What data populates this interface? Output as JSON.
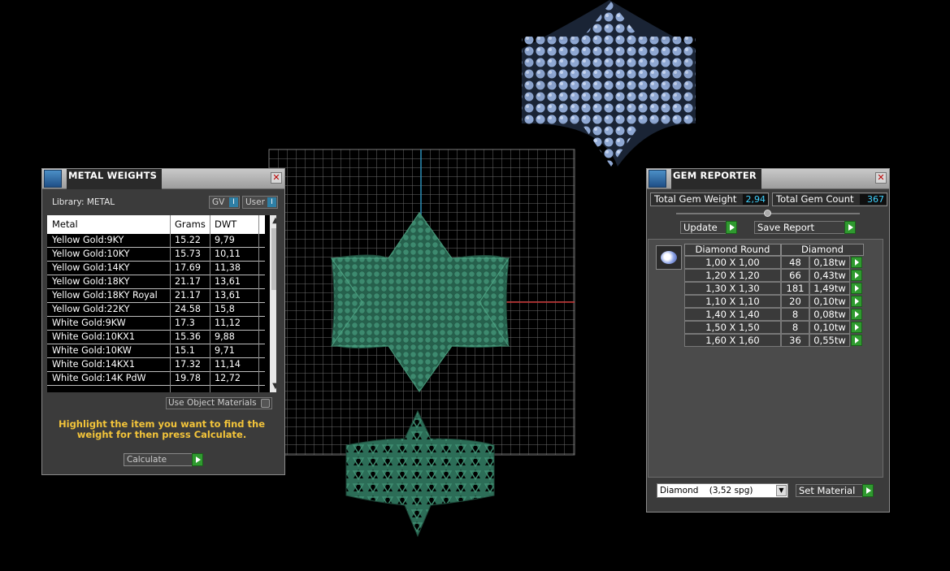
{
  "metal_weights": {
    "title": "METAL WEIGHTS",
    "library_label": "Library: METAL",
    "toggle_gv": "GV",
    "toggle_user": "User",
    "columns": [
      "Metal",
      "Grams",
      "DWT"
    ],
    "rows": [
      {
        "metal": "Yellow Gold:9KY",
        "grams": "15.22",
        "dwt": "9,79"
      },
      {
        "metal": "Yellow Gold:10KY",
        "grams": "15.73",
        "dwt": "10,11"
      },
      {
        "metal": "Yellow Gold:14KY",
        "grams": "17.69",
        "dwt": "11,38"
      },
      {
        "metal": "Yellow Gold:18KY",
        "grams": "21.17",
        "dwt": "13,61"
      },
      {
        "metal": "Yellow Gold:18KY Royal",
        "grams": "21.17",
        "dwt": "13,61"
      },
      {
        "metal": "Yellow Gold:22KY",
        "grams": "24.58",
        "dwt": "15,8"
      },
      {
        "metal": "White Gold:9KW",
        "grams": "17.3",
        "dwt": "11,12"
      },
      {
        "metal": "White Gold:10KX1",
        "grams": "15.36",
        "dwt": "9,88"
      },
      {
        "metal": "White Gold:10KW",
        "grams": "15.1",
        "dwt": "9,71"
      },
      {
        "metal": "White Gold:14KX1",
        "grams": "17.32",
        "dwt": "11,14"
      },
      {
        "metal": "White Gold:14K PdW",
        "grams": "19.78",
        "dwt": "12,72"
      }
    ],
    "use_object_materials": "Use Object Materials",
    "hint": "Highlight the item you want to find the weight for then press Calculate.",
    "calculate_label": "Calculate"
  },
  "gem_reporter": {
    "title": "GEM REPORTER",
    "total_gem_weight_label": "Total Gem Weight",
    "total_gem_weight": "2,94",
    "total_gem_count_label": "Total Gem Count",
    "total_gem_count": "367",
    "update_label": "Update",
    "save_report_label": "Save Report",
    "headers": [
      "Diamond Round",
      "Diamond"
    ],
    "rows": [
      {
        "size": "1,00 X 1,00",
        "count": "48",
        "weight": "0,18tw"
      },
      {
        "size": "1,20 X 1,20",
        "count": "66",
        "weight": "0,43tw"
      },
      {
        "size": "1,30 X 1,30",
        "count": "181",
        "weight": "1,49tw"
      },
      {
        "size": "1,10 X 1,10",
        "count": "20",
        "weight": "0,10tw"
      },
      {
        "size": "1,40 X 1,40",
        "count": "8",
        "weight": "0,08tw"
      },
      {
        "size": "1,50 X 1,50",
        "count": "8",
        "weight": "0,10tw"
      },
      {
        "size": "1,60 X 1,60",
        "count": "36",
        "weight": "0,55tw"
      }
    ],
    "material_select": "Diamond    (3,52 spg)",
    "set_material_label": "Set Material"
  },
  "colors": {
    "panel_bg": "#3b3b3b",
    "gem_value": "#3fd2ff",
    "hint": "#f3c43a",
    "ring_metal": "#2c6d57",
    "gems": "#8fa8d3"
  }
}
